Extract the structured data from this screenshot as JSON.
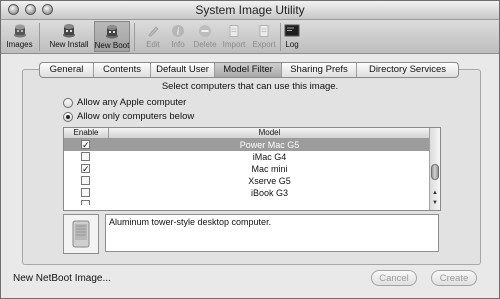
{
  "window": {
    "title": "System Image Utility"
  },
  "toolbar": {
    "items": [
      {
        "label": "Images",
        "icon": "images-icon",
        "enabled": true,
        "selected": false
      },
      {
        "label": "New Install",
        "icon": "new-install-icon",
        "enabled": true,
        "selected": false
      },
      {
        "label": "New Boot",
        "icon": "new-boot-icon",
        "enabled": true,
        "selected": true
      },
      {
        "label": "Edit",
        "icon": "edit-icon",
        "enabled": false,
        "selected": false
      },
      {
        "label": "Info",
        "icon": "info-icon",
        "enabled": false,
        "selected": false
      },
      {
        "label": "Delete",
        "icon": "delete-icon",
        "enabled": false,
        "selected": false
      },
      {
        "label": "Import",
        "icon": "import-icon",
        "enabled": false,
        "selected": false
      },
      {
        "label": "Export",
        "icon": "export-icon",
        "enabled": false,
        "selected": false
      },
      {
        "label": "Log",
        "icon": "log-icon",
        "enabled": true,
        "selected": false
      }
    ]
  },
  "tabs": [
    {
      "label": "General",
      "selected": false
    },
    {
      "label": "Contents",
      "selected": false
    },
    {
      "label": "Default User",
      "selected": false
    },
    {
      "label": "Model Filter",
      "selected": true
    },
    {
      "label": "Sharing Prefs",
      "selected": false
    },
    {
      "label": "Directory Services",
      "selected": false
    }
  ],
  "model_filter": {
    "instruction": "Select computers that can use this image.",
    "options": [
      {
        "label": "Allow any Apple computer",
        "selected": false
      },
      {
        "label": "Allow only computers below",
        "selected": true
      }
    ],
    "table": {
      "headers": {
        "enable": "Enable",
        "model": "Model"
      },
      "rows": [
        {
          "enabled": true,
          "model": "Power Mac G5",
          "selected": true
        },
        {
          "enabled": false,
          "model": "iMac G4",
          "selected": false
        },
        {
          "enabled": true,
          "model": "Mac mini",
          "selected": false
        },
        {
          "enabled": false,
          "model": "Xserve G5",
          "selected": false
        },
        {
          "enabled": false,
          "model": "iBook G3",
          "selected": false
        }
      ]
    },
    "description": "Aluminum tower-style desktop computer."
  },
  "footer": {
    "status": "New NetBoot Image...",
    "cancel_label": "Cancel",
    "create_label": "Create"
  },
  "colors": {
    "selected_row": "#9c9c9c",
    "window_bg": "#e9e9e9"
  }
}
